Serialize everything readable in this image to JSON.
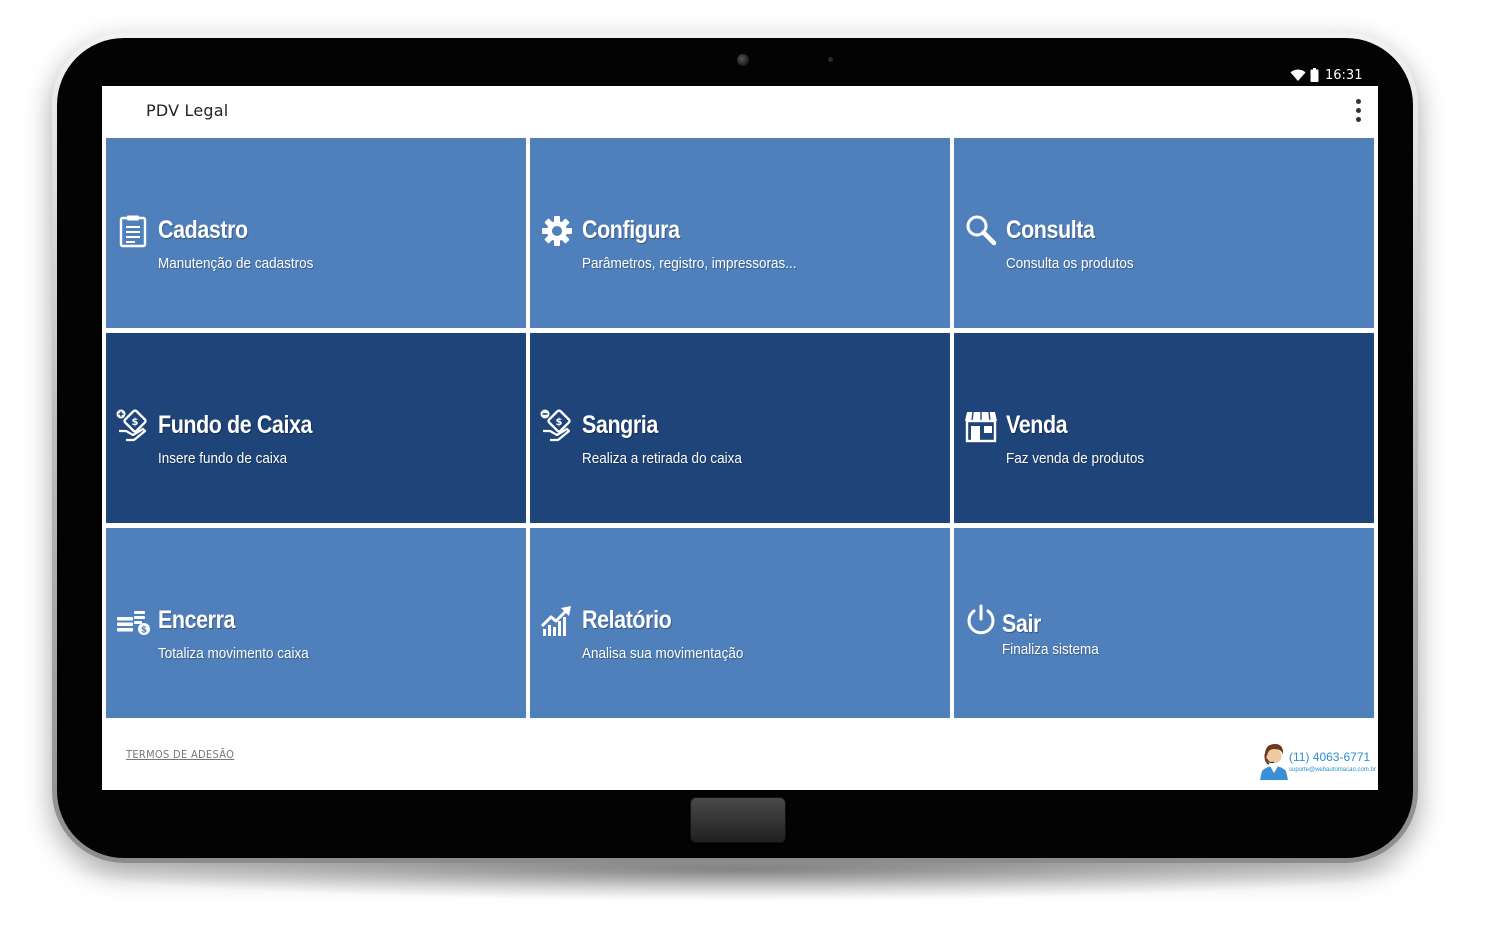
{
  "status_bar": {
    "time": "16:31",
    "wifi_icon": "wifi-icon",
    "battery_icon": "battery-icon"
  },
  "app_bar": {
    "title": "PDV Legal",
    "menu_icon": "more-vertical-icon"
  },
  "tiles": [
    {
      "title": "Cadastro",
      "subtitle": "Manutenção de cadastros",
      "icon": "clipboard-icon",
      "tone": "light"
    },
    {
      "title": "Configura",
      "subtitle": "Parâmetros, registro, impressoras...",
      "icon": "gear-icon",
      "tone": "light"
    },
    {
      "title": "Consulta",
      "subtitle": "Consulta os produtos",
      "icon": "search-icon",
      "tone": "light"
    },
    {
      "title": "Fundo de Caixa",
      "subtitle": "Insere fundo de caixa",
      "icon": "money-in-icon",
      "tone": "dark"
    },
    {
      "title": "Sangria",
      "subtitle": "Realiza a retirada do caixa",
      "icon": "money-out-icon",
      "tone": "dark"
    },
    {
      "title": "Venda",
      "subtitle": "Faz venda de produtos",
      "icon": "store-icon",
      "tone": "dark"
    },
    {
      "title": "Encerra",
      "subtitle": "Totaliza movimento caixa",
      "icon": "coins-icon",
      "tone": "light"
    },
    {
      "title": "Relatório",
      "subtitle": "Analisa sua movimentação",
      "icon": "chart-up-icon",
      "tone": "light"
    },
    {
      "title": "Sair",
      "subtitle": "Finaliza sistema",
      "icon": "power-icon",
      "tone": "light"
    }
  ],
  "footer": {
    "terms_link": "TERMOS DE ADESÃO",
    "support_phone": "(11) 4063-6771",
    "support_email": "suporte@webautomacao.com.br",
    "support_icon": "support-agent-icon"
  },
  "colors": {
    "tile_light": "#5080bc",
    "tile_dark": "#1f4479",
    "accent_link": "#2a8fd1"
  }
}
